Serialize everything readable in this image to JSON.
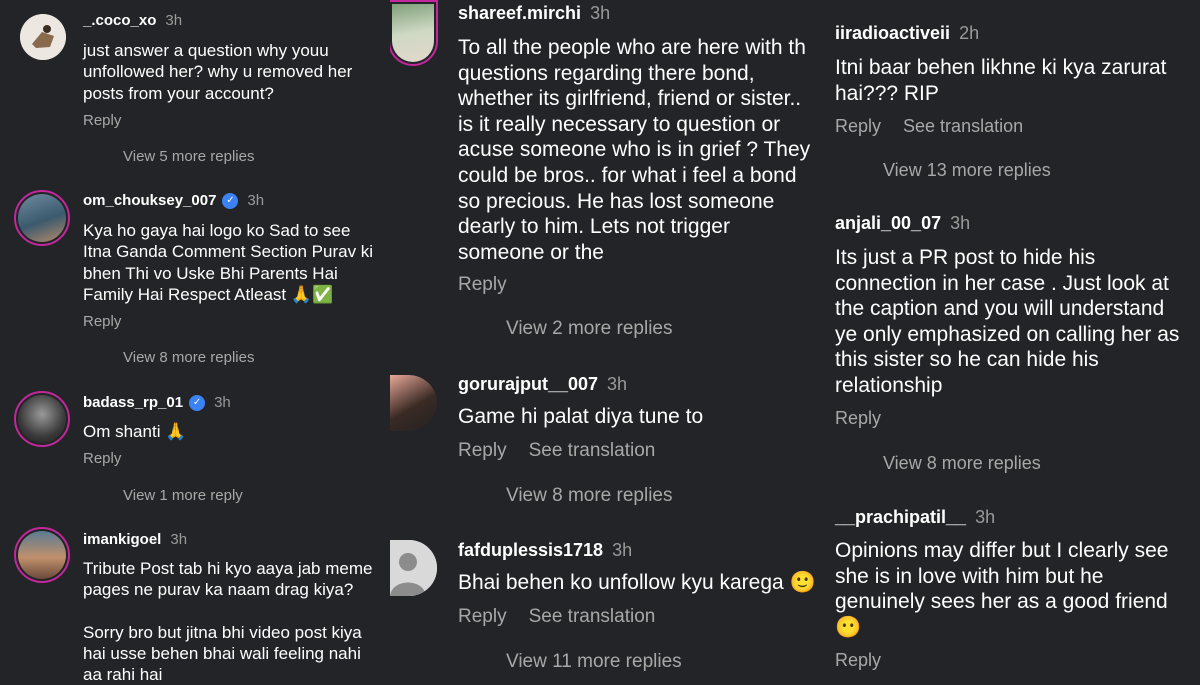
{
  "col1": [
    {
      "user": "_.coco_xo",
      "time": "3h",
      "text": "just answer a question why youu\nunfollowed her? why u removed her\nposts from your account?",
      "reply": "Reply",
      "more": "View 5 more replies"
    },
    {
      "user": "om_chouksey_007",
      "time": "3h",
      "text": "Kya ho gaya hai logo ko Sad to see\nItna Ganda Comment Section Purav ki\nbhen Thi vo Uske Bhi Parents Hai\nFamily Hai Respect Atleast 🙏✅",
      "reply": "Reply",
      "more": "View 8 more replies"
    },
    {
      "user": "badass_rp_01",
      "time": "3h",
      "text": "Om shanti 🙏",
      "reply": "Reply",
      "more": "View 1 more reply"
    },
    {
      "user": "imankigoel",
      "time": "3h",
      "text": "Tribute Post tab hi kyo aaya jab meme\npages ne purav ka naam drag kiya?\n\nSorry bro but jitna bhi video post kiya\nhai usse behen bhai wali feeling nahi\naa rahi hai"
    }
  ],
  "col2": [
    {
      "user": "shareef.mirchi",
      "time": "3h",
      "text": "To all the people who are here with th\nquestions regarding there bond,\nwhether its girlfriend, friend or sister..\nis it really necessary to question or\nacuse someone who is in grief ? They\ncould be bros.. for what i feel a bond\nso precious. He has lost someone\ndearly to him. Lets not trigger\nsomeone or the",
      "reply": "Reply",
      "more": "View 2 more replies"
    },
    {
      "user": "gorurajput__007",
      "time": "3h",
      "text": "Game hi palat diya tune to",
      "reply": "Reply",
      "translate": "See translation",
      "more": "View 8 more replies"
    },
    {
      "user": "fafduplessis1718",
      "time": "3h",
      "text": "Bhai behen ko unfollow kyu karega 🙂",
      "reply": "Reply",
      "translate": "See translation",
      "more": "View 11 more replies"
    }
  ],
  "col3": [
    {
      "user": "iiradioactiveii",
      "time": "2h",
      "text": "Itni baar behen likhne ki kya zarurat\nhai??? RIP",
      "reply": "Reply",
      "translate": "See translation",
      "more": "View 13 more replies"
    },
    {
      "user": "anjali_00_07",
      "time": "3h",
      "text": "Its just a PR post to hide his\nconnection in her case . Just look at\nthe caption and you will understand\nye only emphasized on calling her as\nthis sister so he can hide his\nrelationship",
      "reply": "Reply",
      "more": "View 8 more replies"
    },
    {
      "user": "__prachipatil__",
      "time": "3h",
      "text": "Opinions may differ but I clearly see\nshe is in love with him but he\ngenuinely sees her as a good friend\n😶",
      "reply": "Reply"
    }
  ]
}
